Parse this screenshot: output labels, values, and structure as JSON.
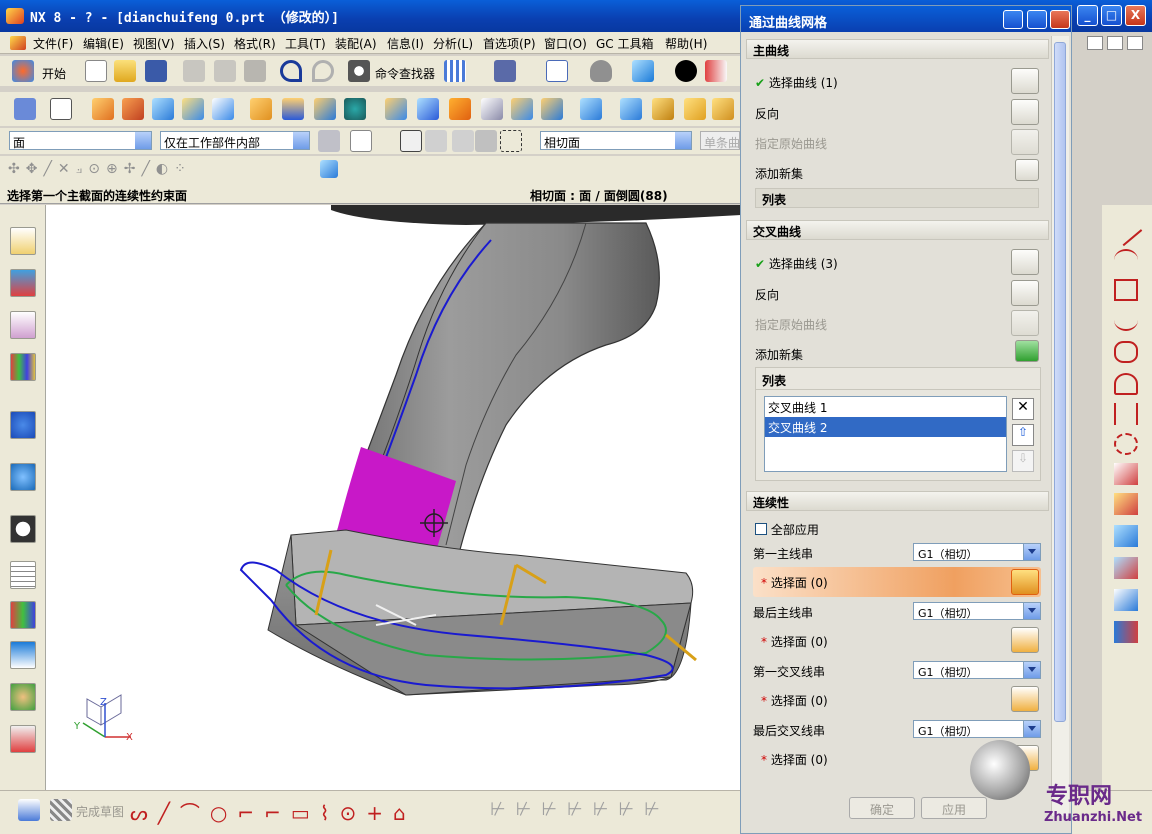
{
  "window": {
    "title": "NX 8 - ? - [dianchuifeng 0.prt （修改的）]",
    "min": "_",
    "max": "□",
    "close": "X"
  },
  "menu": [
    "文件(F)",
    "编辑(E)",
    "视图(V)",
    "插入(S)",
    "格式(R)",
    "工具(T)",
    "装配(A)",
    "信息(I)",
    "分析(L)",
    "首选项(P)",
    "窗口(O)",
    "GC 工具箱",
    "帮助(H)"
  ],
  "toolbar1": {
    "start_label": "开始",
    "cmd_finder": "命令查找器"
  },
  "selectbar": {
    "filter": "面",
    "scope": "仅在工作部件内部",
    "face_rule": "相切面",
    "single": "单条曲"
  },
  "status": {
    "prompt": "选择第一个主截面的连续性约束面",
    "selection": "相切面 : 面 / 面倒圆(88)"
  },
  "dialog": {
    "title": "通过曲线网格",
    "primary": {
      "header": "主曲线",
      "select": "选择曲线 (1)",
      "reverse": "反向",
      "origin": "指定原始曲线",
      "add": "添加新集",
      "list": "列表"
    },
    "cross": {
      "header": "交叉曲线",
      "select": "选择曲线 (3)",
      "reverse": "反向",
      "origin": "指定原始曲线",
      "add": "添加新集",
      "list": "列表",
      "items": [
        "交叉曲线 1",
        "交叉曲线 2"
      ]
    },
    "continuity": {
      "header": "连续性",
      "apply_all": "全部应用",
      "rows": [
        {
          "label": "第一主线串",
          "value": "G1（相切）",
          "face": "选择面 (0)"
        },
        {
          "label": "最后主线串",
          "value": "G1（相切）",
          "face": "选择面 (0)"
        },
        {
          "label": "第一交叉线串",
          "value": "G1（相切）",
          "face": "选择面 (0)"
        },
        {
          "label": "最后交叉线串",
          "value": "G1（相切）",
          "face": "选择面 (0)"
        }
      ]
    },
    "ok": "确定",
    "apply": "应用"
  },
  "bottombar": {
    "finish_sketch": "完成草图"
  },
  "watermark": {
    "brand": "专职网",
    "url": "Zhuanzhi.Net"
  },
  "axes": {
    "x": "X",
    "y": "Y",
    "z": "Z"
  },
  "colors": {
    "highlight": "#c818c8",
    "primary_curve": "#1a1ad0",
    "cross_curve": "#28a848",
    "vector": "#d8a018"
  }
}
